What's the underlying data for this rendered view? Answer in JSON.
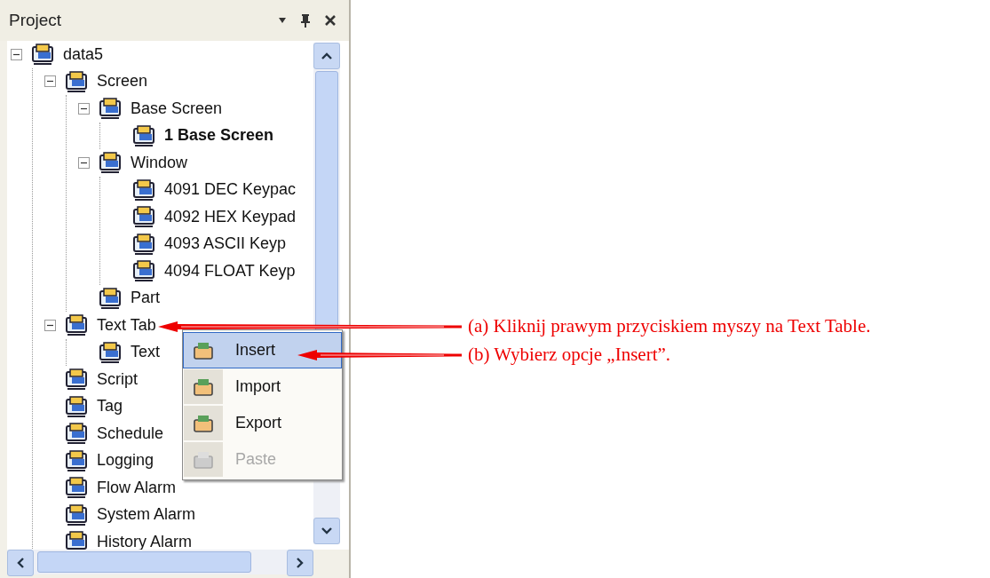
{
  "panel": {
    "title": "Project"
  },
  "tree": [
    {
      "label": "data5",
      "expanded": true,
      "active": false,
      "children": [
        {
          "label": "Screen",
          "expanded": true,
          "active": false,
          "children": [
            {
              "label": "Base Screen",
              "expanded": true,
              "active": false,
              "children": [
                {
                  "label": "1 Base Screen",
                  "active": true
                }
              ]
            },
            {
              "label": "Window",
              "expanded": true,
              "active": false,
              "children": [
                {
                  "label": "4091 DEC Keypac",
                  "active": false
                },
                {
                  "label": "4092 HEX Keypad",
                  "active": false
                },
                {
                  "label": "4093 ASCII Keyp",
                  "active": false
                },
                {
                  "label": "4094 FLOAT Keyp",
                  "active": false
                }
              ]
            },
            {
              "label": "Part",
              "active": false
            }
          ]
        },
        {
          "label": "Text Tab",
          "expanded": true,
          "active": false,
          "children": [
            {
              "label": "Text",
              "active": false
            }
          ]
        },
        {
          "label": "Script",
          "active": false
        },
        {
          "label": "Tag",
          "active": false
        },
        {
          "label": "Schedule",
          "active": false
        },
        {
          "label": "Logging",
          "active": false
        },
        {
          "label": "Flow Alarm",
          "active": false
        },
        {
          "label": "System Alarm",
          "active": false
        },
        {
          "label": "History Alarm",
          "active": false
        }
      ]
    }
  ],
  "context_menu": [
    {
      "label": "Insert",
      "selected": true,
      "disabled": false
    },
    {
      "label": "Import",
      "selected": false,
      "disabled": false
    },
    {
      "label": "Export",
      "selected": false,
      "disabled": false
    },
    {
      "label": "Paste",
      "selected": false,
      "disabled": true
    }
  ],
  "annotations": [
    {
      "label": "(a) Kliknij prawym przyciskiem myszy na Text Table."
    },
    {
      "label": "(b) Wybierz opcje „Insert”."
    }
  ]
}
